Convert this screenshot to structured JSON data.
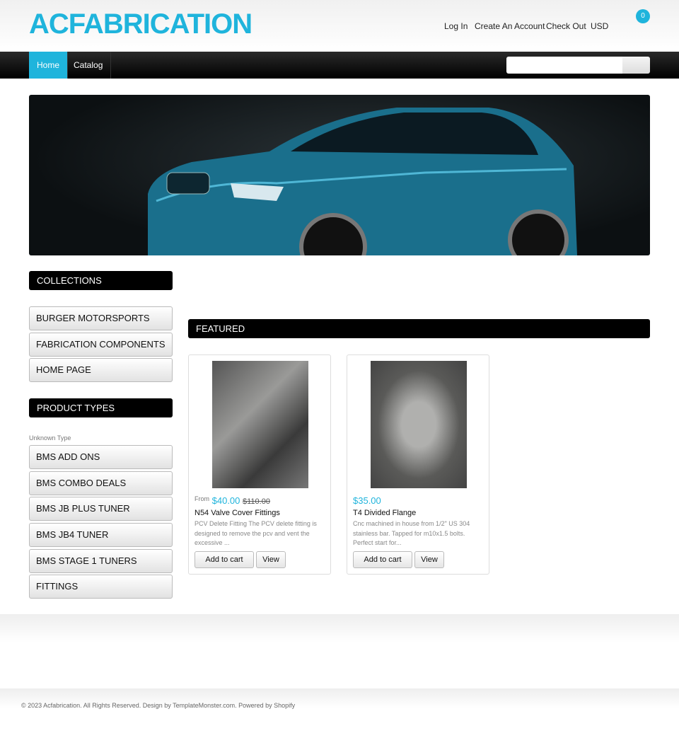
{
  "header": {
    "logo": "ACFABRICATION",
    "links": [
      "Log In",
      "Create An Account",
      "Check Out",
      "USD"
    ],
    "cart_count": "0"
  },
  "nav": {
    "tabs": [
      "Home",
      "Catalog"
    ],
    "active": "Home",
    "search_placeholder": ""
  },
  "sidebar": {
    "collections_title": "COLLECTIONS",
    "collections": [
      "BURGER MOTORSPORTS",
      "FABRICATION COMPONENTS",
      "HOME PAGE"
    ],
    "types_title": "PRODUCT TYPES",
    "unknown_type": "Unknown Type",
    "types": [
      "BMS ADD ONS",
      "BMS COMBO DEALS",
      "BMS JB PLUS TUNER",
      "BMS JB4 TUNER",
      "BMS STAGE 1 TUNERS",
      "FITTINGS"
    ]
  },
  "featured": {
    "title": "FEATURED",
    "products": [
      {
        "from": "From",
        "price": "$40.00",
        "compare": "$110.00",
        "name": "N54 Valve Cover Fittings",
        "desc": "PCV Delete Fitting  The PCV delete fitting is designed  to remove the pcv and vent the excessive ...",
        "add": "Add to cart",
        "view": "View"
      },
      {
        "from": "",
        "price": "$35.00",
        "compare": "",
        "name": "T4 Divided Flange",
        "desc": "Cnc machined in house from 1/2\" US 304 stainless bar. Tapped for m10x1.5 bolts. Perfect start for...",
        "add": "Add to cart",
        "view": "View"
      }
    ]
  },
  "footer": {
    "copyright": "© 2023 Acfabrication. All Rights Reserved. Design by TemplateMonster.com. Powered by Shopify"
  },
  "colors": {
    "accent": "#1fb4dc",
    "nav": "#000000"
  }
}
